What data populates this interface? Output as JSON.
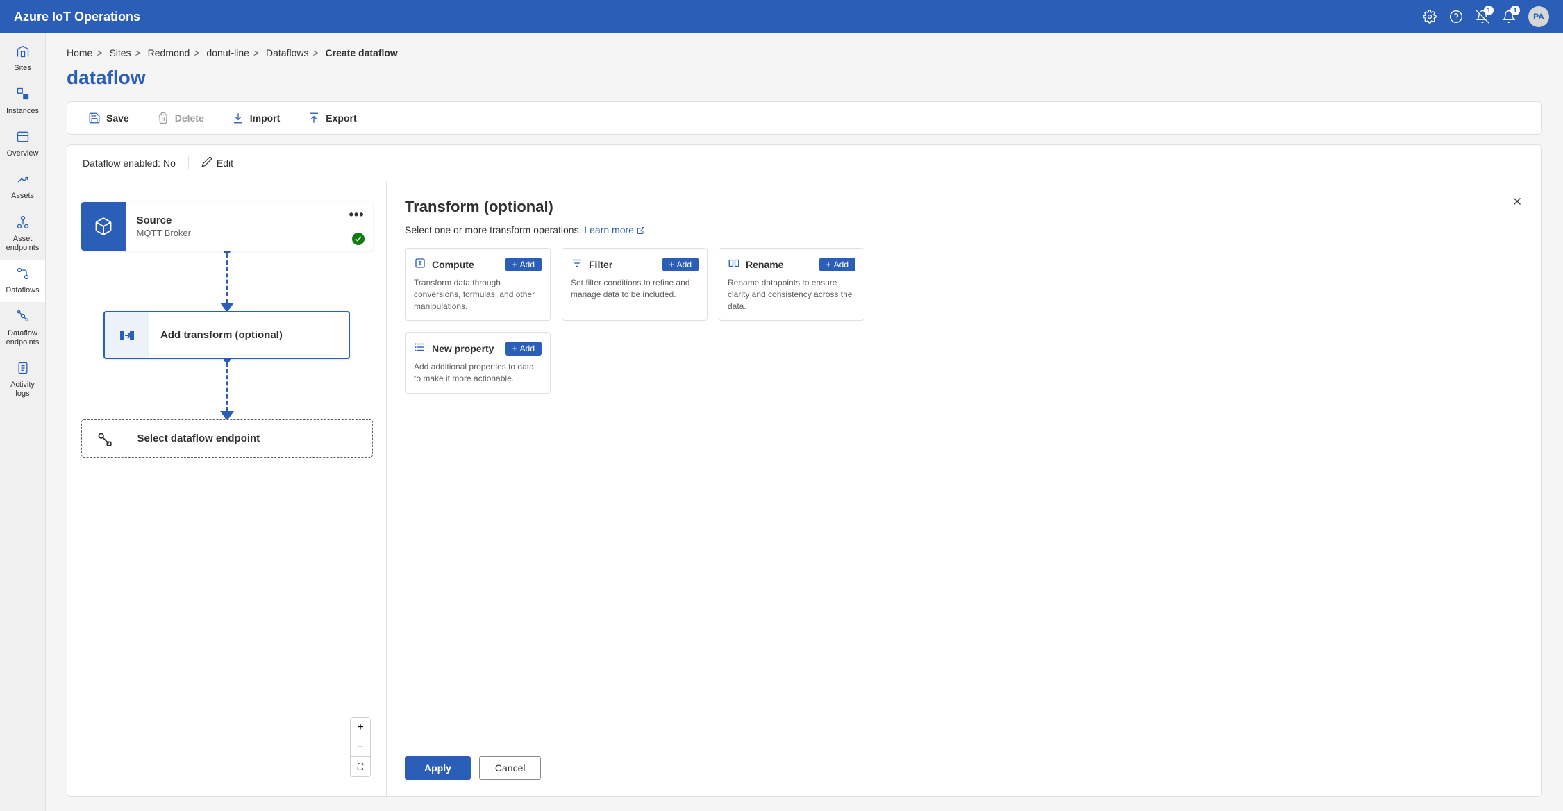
{
  "header": {
    "title": "Azure IoT Operations",
    "notification_badge_1": "1",
    "notification_badge_2": "1",
    "avatar": "PA"
  },
  "sidebar": {
    "items": [
      {
        "label": "Sites"
      },
      {
        "label": "Instances"
      },
      {
        "label": "Overview"
      },
      {
        "label": "Assets"
      },
      {
        "label": "Asset endpoints"
      },
      {
        "label": "Dataflows"
      },
      {
        "label": "Dataflow endpoints"
      },
      {
        "label": "Activity logs"
      }
    ]
  },
  "breadcrumb": {
    "items": [
      "Home",
      "Sites",
      "Redmond",
      "donut-line",
      "Dataflows"
    ],
    "current": "Create dataflow"
  },
  "page_title": "dataflow",
  "toolbar": {
    "save": "Save",
    "delete": "Delete",
    "import": "Import",
    "export": "Export"
  },
  "status_row": {
    "enabled_label": "Dataflow enabled: No",
    "edit": "Edit"
  },
  "nodes": {
    "source": {
      "title": "Source",
      "subtitle": "MQTT Broker"
    },
    "transform": {
      "title": "Add transform (optional)"
    },
    "endpoint": {
      "title": "Select dataflow endpoint"
    }
  },
  "panel": {
    "title": "Transform (optional)",
    "subtitle_text": "Select one or more transform operations. ",
    "learn_more": "Learn more",
    "cards": [
      {
        "title": "Compute",
        "desc": "Transform data through conversions, formulas, and other manipulations.",
        "add": "Add"
      },
      {
        "title": "Filter",
        "desc": "Set filter conditions to refine and manage data to be included.",
        "add": "Add"
      },
      {
        "title": "Rename",
        "desc": "Rename datapoints to ensure clarity and consistency across the data.",
        "add": "Add"
      },
      {
        "title": "New property",
        "desc": "Add additional properties to data to make it more actionable.",
        "add": "Add"
      }
    ],
    "apply": "Apply",
    "cancel": "Cancel"
  }
}
